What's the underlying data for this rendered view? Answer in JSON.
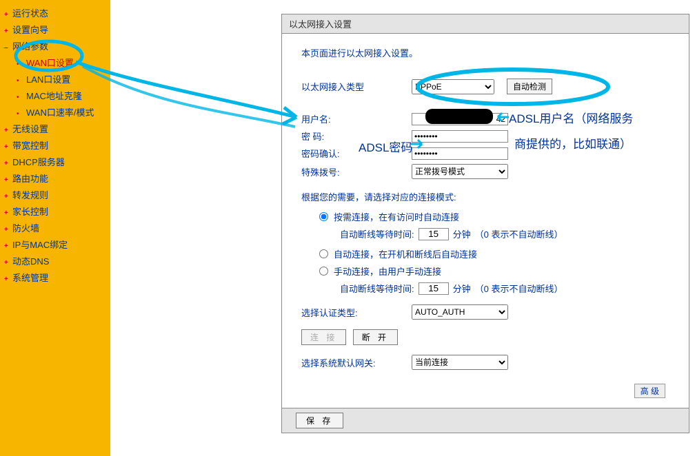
{
  "sidebar": {
    "items": [
      {
        "label": "运行状态",
        "bullet": "plus",
        "red": false,
        "sub": false
      },
      {
        "label": "设置向导",
        "bullet": "plus",
        "red": false,
        "sub": false
      },
      {
        "label": "网络参数",
        "bullet": "minus",
        "red": false,
        "sub": false
      },
      {
        "label": "WAN口设置",
        "bullet": "dot",
        "red": true,
        "sub": true
      },
      {
        "label": "LAN口设置",
        "bullet": "dot",
        "red": false,
        "sub": true
      },
      {
        "label": "MAC地址克隆",
        "bullet": "dot",
        "red": false,
        "sub": true
      },
      {
        "label": "WAN口速率/模式",
        "bullet": "dot",
        "red": false,
        "sub": true
      },
      {
        "label": "无线设置",
        "bullet": "plus",
        "red": false,
        "sub": false
      },
      {
        "label": "带宽控制",
        "bullet": "plus",
        "red": false,
        "sub": false
      },
      {
        "label": "DHCP服务器",
        "bullet": "plus",
        "red": false,
        "sub": false
      },
      {
        "label": "路由功能",
        "bullet": "plus",
        "red": false,
        "sub": false
      },
      {
        "label": "转发规则",
        "bullet": "plus",
        "red": false,
        "sub": false
      },
      {
        "label": "家长控制",
        "bullet": "plus",
        "red": false,
        "sub": false
      },
      {
        "label": "防火墙",
        "bullet": "plus",
        "red": false,
        "sub": false
      },
      {
        "label": "IP与MAC绑定",
        "bullet": "plus",
        "red": false,
        "sub": false
      },
      {
        "label": "动态DNS",
        "bullet": "plus",
        "red": false,
        "sub": false
      },
      {
        "label": "系统管理",
        "bullet": "plus",
        "red": false,
        "sub": false
      }
    ]
  },
  "panel": {
    "title": "以太网接入设置",
    "desc": "本页面进行以太网接入设置。",
    "conn_type_label": "以太网接入类型",
    "conn_type_value": "PPPoE",
    "detect_btn": "自动检测",
    "username_label": "用户名:",
    "username_value": "42",
    "password_label": "密 码:",
    "password_value": "••••••••",
    "password_confirm_label": "密码确认:",
    "password_confirm_value": "••••••••",
    "dial_label": "特殊拨号:",
    "dial_value": "正常拨号模式",
    "mode_desc": "根据您的需要，请选择对应的连接模式:",
    "mode1": "按需连接，在有访问时自动连接",
    "wait_label": "自动断线等待时间:",
    "wait_value": "15",
    "wait_unit": "分钟",
    "wait_hint": "（0 表示不自动断线）",
    "mode2": "自动连接，在开机和断线后自动连接",
    "mode3": "手动连接，由用户手动连接",
    "auth_label": "选择认证类型:",
    "auth_value": "AUTO_AUTH",
    "connect_btn": "连 接",
    "disconnect_btn": "断 开",
    "gw_label": "选择系统默认网关:",
    "gw_value": "当前连接",
    "adv_btn": "高 级",
    "save_btn": "保 存"
  },
  "annotations": {
    "user": "ADSL用户名（网络服务",
    "isp": "商提供的，比如联通）",
    "pwd": "ADSL密码"
  }
}
